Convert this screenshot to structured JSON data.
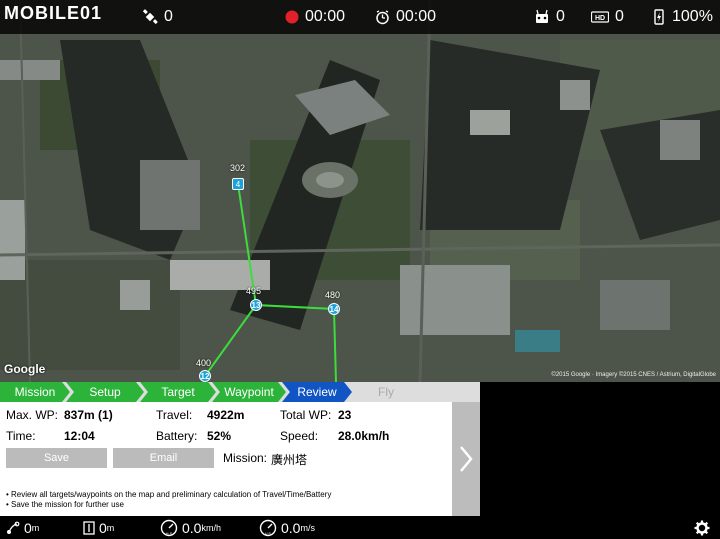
{
  "top": {
    "watermark": "MOBILE01",
    "satellites": "0",
    "rec_time": "00:00",
    "flight_time": "00:00",
    "rc_signal": "0",
    "video_signal": "0",
    "battery": "100%"
  },
  "map": {
    "waypoints": [
      {
        "id": "4",
        "alt": "302"
      },
      {
        "id": "13",
        "alt": "495"
      },
      {
        "id": "14",
        "alt": "480"
      },
      {
        "id": "12",
        "alt": "400"
      }
    ],
    "google": "Google",
    "credit": "©2015 Google · Imagery ©2015 CNES / Astrium, DigitalGlobe"
  },
  "tabs": [
    "Mission",
    "Setup",
    "Target",
    "Waypoint",
    "Review",
    "Fly"
  ],
  "panel": {
    "maxwp_label": "Max. WP:",
    "maxwp_value": "837m (1)",
    "travel_label": "Travel:",
    "travel_value": "4922m",
    "totalwp_label": "Total WP:",
    "totalwp_value": "23",
    "time_label": "Time:",
    "time_value": "12:04",
    "battery_label": "Battery:",
    "battery_value": "52%",
    "speed_label": "Speed:",
    "speed_value": "28.0km/h",
    "save": "Save",
    "email": "Email",
    "mission_label": "Mission:",
    "mission_value": "廣州塔",
    "note1": "• Review all targets/waypoints on the map and preliminary calculation of Travel/Time/Battery",
    "note2": "• Save the mission for further use"
  },
  "bottom": {
    "distance": "0",
    "distance_unit": "m",
    "height": "0",
    "height_unit": "m",
    "hspeed": "0.0",
    "hspeed_unit": "km/h",
    "vspeed": "0.0",
    "vspeed_unit": "m/s"
  },
  "colors": {
    "tab_green": "#2bb33a",
    "tab_active": "#1155c4",
    "tab_inactive": "#dddddd",
    "waypoint": "#1aa3d9",
    "path": "#3ddc3d"
  }
}
